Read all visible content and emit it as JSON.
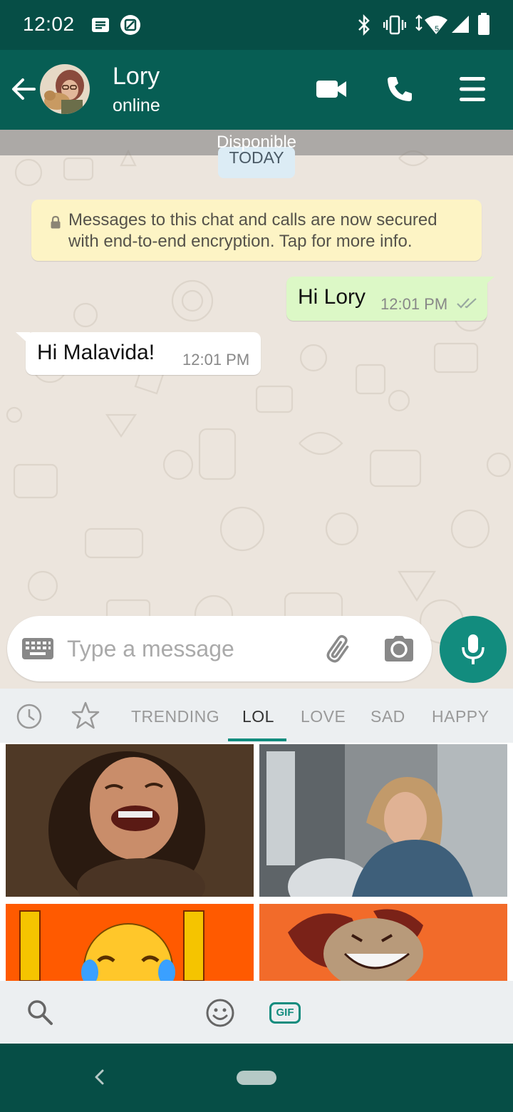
{
  "status_bar": {
    "time": "12:02",
    "icons": [
      "message-notification-icon",
      "image-notification-icon",
      "bluetooth-icon",
      "vibrate-icon",
      "wifi-icon",
      "signal-icon",
      "battery-icon"
    ]
  },
  "header": {
    "contact_name": "Lory",
    "contact_status": "online",
    "actions": [
      "video-call-icon",
      "voice-call-icon",
      "menu-icon"
    ]
  },
  "chat": {
    "overlay_text": "Disponible",
    "date_chip": "TODAY",
    "encryption_line1": "Messages to this chat and calls are now secured",
    "encryption_line2": "with end-to-end encryption. Tap for more info.",
    "messages": [
      {
        "direction": "outgoing",
        "text": "Hi Lory",
        "time": "12:01 PM",
        "status": "read"
      },
      {
        "direction": "incoming",
        "text": "Hi Malavida!",
        "time": "12:01 PM"
      }
    ]
  },
  "composer": {
    "placeholder": "Type a message",
    "value": ""
  },
  "gif_keyboard": {
    "tabs": [
      "TRENDING",
      "LOL",
      "LOVE",
      "SAD",
      "HAPPY"
    ],
    "active_tab": "LOL",
    "bottom_gif_label": "GIF"
  },
  "colors": {
    "header": "#075e54",
    "status_bar": "#064e46",
    "accent": "#128c7e",
    "outgoing_bubble": "#dcf8c6",
    "incoming_bubble": "#ffffff",
    "chat_background": "#ece5dd",
    "encryption_note": "#fdf4c5",
    "read_ticks": "#4fc3f7"
  }
}
